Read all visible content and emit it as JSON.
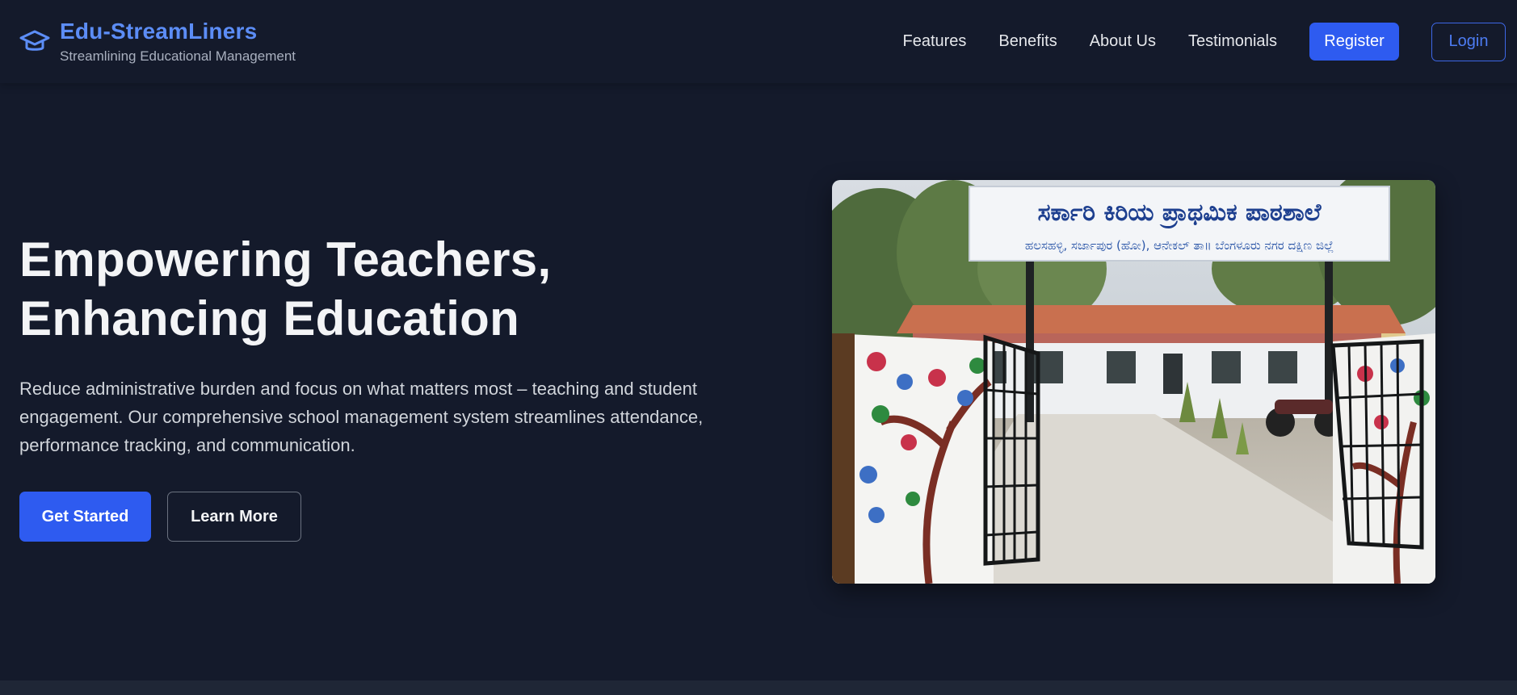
{
  "brand": {
    "name": "Edu-StreamLiners",
    "tagline": "Streamlining Educational Management",
    "icon": "graduation-cap-icon"
  },
  "nav": {
    "links": [
      "Features",
      "Benefits",
      "About Us",
      "Testimonials"
    ],
    "register_label": "Register",
    "login_label": "Login"
  },
  "hero": {
    "title_line1": "Empowering Teachers,",
    "title_line2": "Enhancing Education",
    "description": "Reduce administrative burden and focus on what matters most – teaching and student engagement. Our comprehensive school management system streamlines attendance, performance tracking, and communication.",
    "primary_cta": "Get Started",
    "secondary_cta": "Learn More",
    "image": {
      "sign_line1": "ಸರ್ಕಾರಿ ಕಿರಿಯ ಪ್ರಾಥಮಿಕ ಪಾಠಶಾಲೆ",
      "sign_line2": "ಹಲಸಹಳ್ಳಿ, ಸರ್ಜಾಪುರ (ಹೋ), ಆನೇಕಲ್ ತಾ॥ ಬೆಂಗಳೂರು ನಗರ ದಕ್ಷಿಣ ಜಿಲ್ಲೆ"
    }
  },
  "colors": {
    "background": "#141a2b",
    "accent": "#2e5bf0",
    "brand": "#5c8df6"
  }
}
